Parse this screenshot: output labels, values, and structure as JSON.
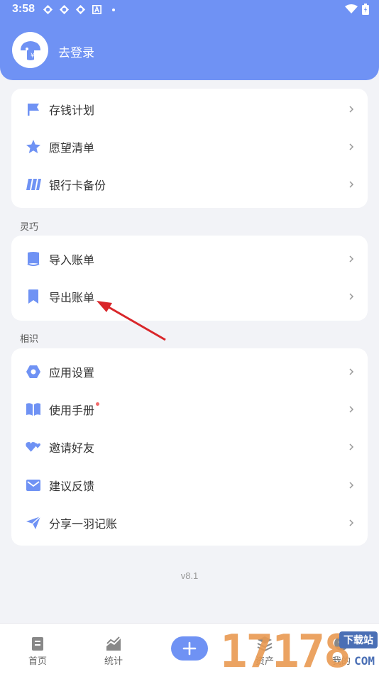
{
  "status_bar": {
    "time": "3:58"
  },
  "header": {
    "login_text": "去登录"
  },
  "group1": {
    "items": [
      {
        "label": "存钱计划",
        "icon": "flag-icon"
      },
      {
        "label": "愿望清单",
        "icon": "star-icon"
      },
      {
        "label": "银行卡备份",
        "icon": "card-stripes-icon"
      }
    ]
  },
  "group2": {
    "title": "灵巧",
    "items": [
      {
        "label": "导入账单",
        "icon": "import-book-icon"
      },
      {
        "label": "导出账单",
        "icon": "bookmark-icon"
      }
    ]
  },
  "group3": {
    "title": "相识",
    "items": [
      {
        "label": "应用设置",
        "icon": "settings-hex-icon"
      },
      {
        "label": "使用手册",
        "icon": "open-book-icon",
        "badge": true
      },
      {
        "label": "邀请好友",
        "icon": "hearts-icon"
      },
      {
        "label": "建议反馈",
        "icon": "mail-icon"
      },
      {
        "label": "分享一羽记账",
        "icon": "paper-plane-icon"
      }
    ]
  },
  "version": "v8.1",
  "tabbar": {
    "tabs": [
      {
        "label": "首页",
        "icon": "document-icon"
      },
      {
        "label": "统计",
        "icon": "trend-chart-icon"
      },
      {
        "label": "资产",
        "icon": "layers-icon"
      },
      {
        "label": "我的",
        "icon": "profile-icon"
      }
    ],
    "add_icon": "plus-icon"
  },
  "watermark": {
    "digits": "17178",
    "badge": "下载站",
    "domain": "COM"
  },
  "colors": {
    "accent": "#6f92f4",
    "annotation": "#d9262a"
  }
}
